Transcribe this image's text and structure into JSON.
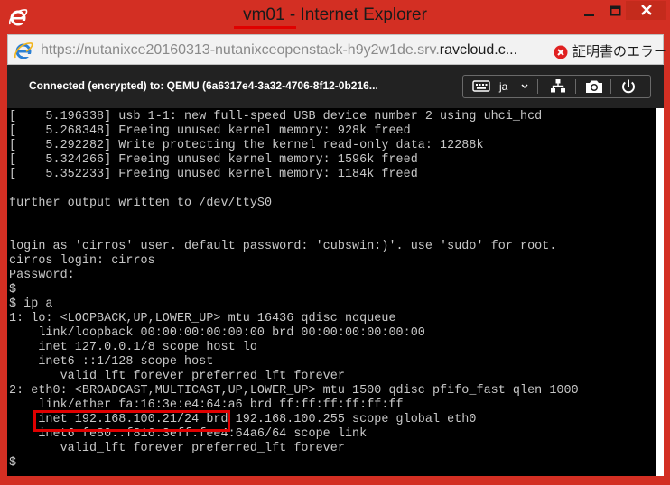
{
  "window": {
    "title_vm": "vm01",
    "title_rest": " - Internet Explorer",
    "controls": [
      "minimize-icon",
      "maximize-icon",
      "close-icon"
    ]
  },
  "address": {
    "url_prefix": "https://nutanixce20160313-nutanixceopenstack-h9y2w1de.srv.",
    "url_domain": "ravcloud.c...",
    "cert_error": "証明書のエラー"
  },
  "console": {
    "status": "Connected (encrypted) to: QEMU (6a6317e4-3a32-4706-8f12-0b216...",
    "keyboard_lang": "ja",
    "tools": [
      "keyboard-icon",
      "network-icon",
      "camera-icon",
      "power-icon"
    ]
  },
  "terminal": {
    "lines": [
      "[    5.196338] usb 1-1: new full-speed USB device number 2 using uhci_hcd",
      "[    5.268348] Freeing unused kernel memory: 928k freed",
      "[    5.292282] Write protecting the kernel read-only data: 12288k",
      "[    5.324266] Freeing unused kernel memory: 1596k freed",
      "[    5.352233] Freeing unused kernel memory: 1184k freed",
      "",
      "further output written to /dev/ttyS0",
      "",
      "",
      "login as 'cirros' user. default password: 'cubswin:)'. use 'sudo' for root.",
      "cirros login: cirros",
      "Password:",
      "$",
      "$ ip a",
      "1: lo: <LOOPBACK,UP,LOWER_UP> mtu 16436 qdisc noqueue",
      "    link/loopback 00:00:00:00:00:00 brd 00:00:00:00:00:00",
      "    inet 127.0.0.1/8 scope host lo",
      "    inet6 ::1/128 scope host",
      "       valid_lft forever preferred_lft forever",
      "2: eth0: <BROADCAST,MULTICAST,UP,LOWER_UP> mtu 1500 qdisc pfifo_fast qlen 1000",
      "    link/ether fa:16:3e:e4:64:a6 brd ff:ff:ff:ff:ff:ff",
      "    inet 192.168.100.21/24 brd 192.168.100.255 scope global eth0",
      "    inet6 fe80::f816:3eff:fee4:64a6/64 scope link",
      "       valid_lft forever preferred_lft forever",
      "$"
    ]
  },
  "colors": {
    "window_frame": "#d32f23",
    "console_toolbar": "#222222",
    "terminal_bg": "#000000",
    "terminal_fg": "#c8c8c8",
    "annotation": "#e00000"
  }
}
